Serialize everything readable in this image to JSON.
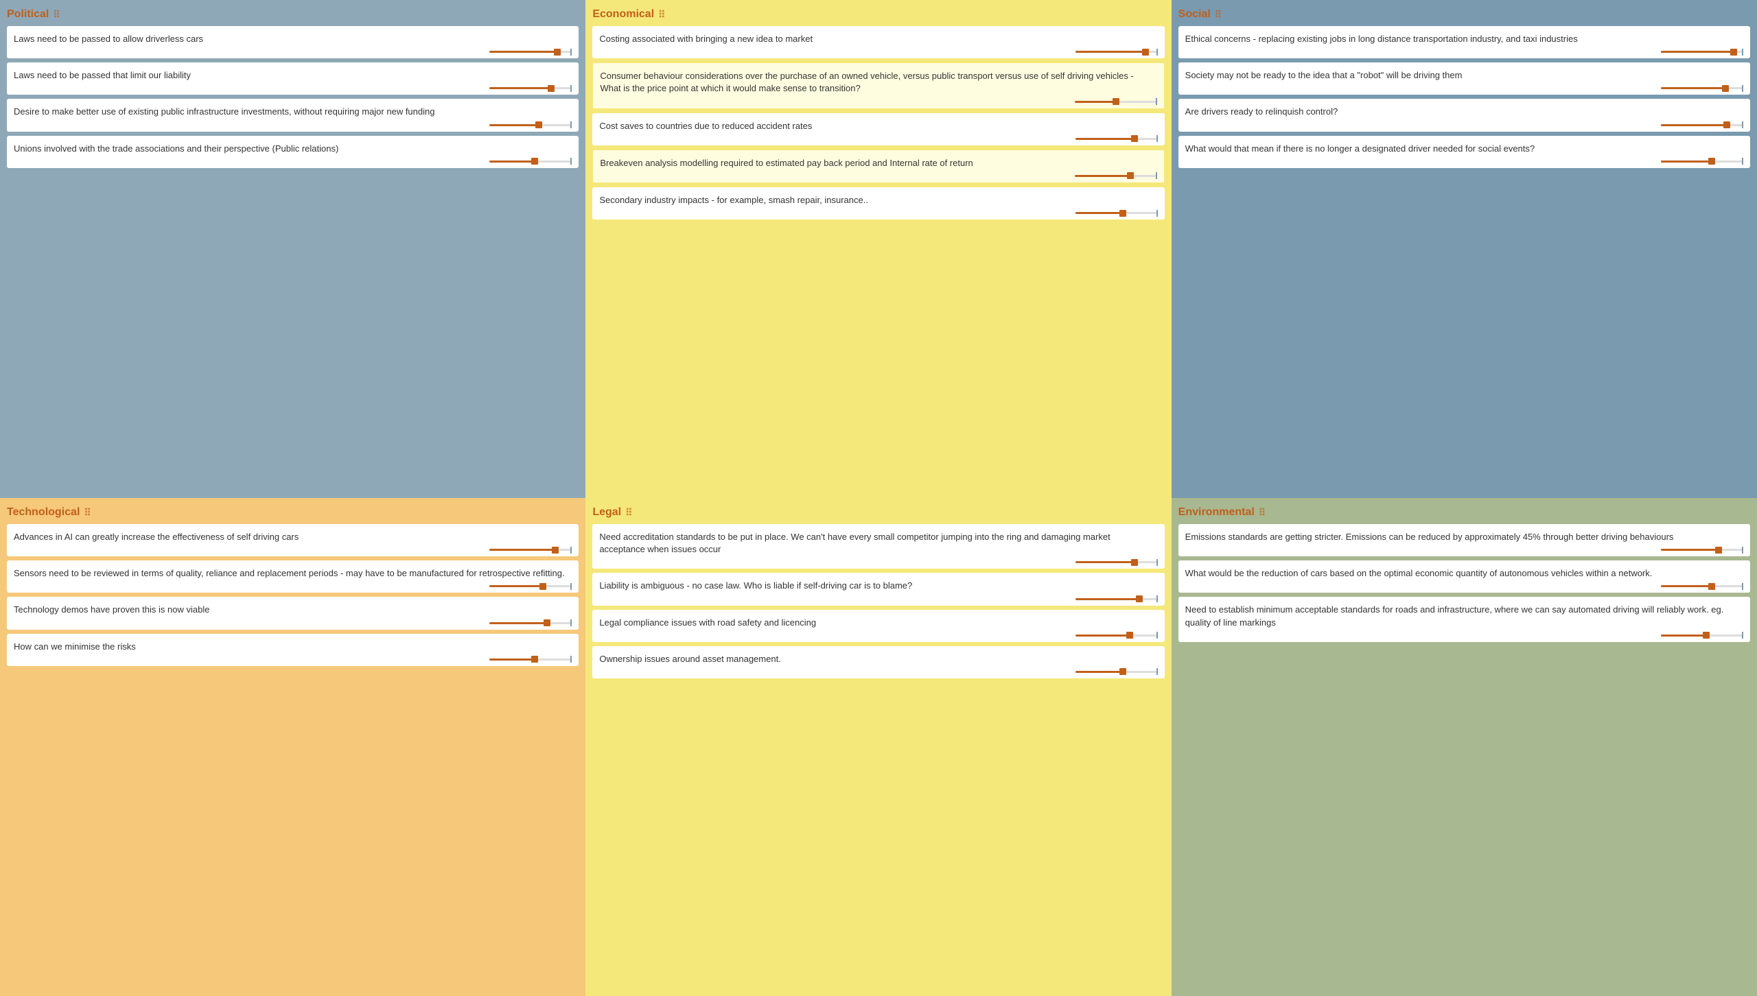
{
  "columns": [
    {
      "id": "political",
      "title": "Political",
      "colorClass": "political",
      "cards": [
        {
          "text": "Laws need to be passed to allow driverless cars",
          "sliderPct": 82
        },
        {
          "text": "Laws need to be passed that limit our liability",
          "sliderPct": 75
        },
        {
          "text": "Desire to make better use of existing public infrastructure investments, without requiring major new funding",
          "sliderPct": 60
        },
        {
          "text": "Unions involved with the trade associations and their perspective (Public relations)",
          "sliderPct": 55
        }
      ]
    },
    {
      "id": "economical",
      "title": "Economical",
      "colorClass": "economical",
      "cards": [
        {
          "text": "Costing associated with bringing a new idea to market",
          "sliderPct": 85
        },
        {
          "text": "Consumer behaviour considerations over the purchase of an owned vehicle, versus public transport versus use of self driving vehicles - What is the price point at which it would make sense to transition?",
          "sliderPct": 50,
          "highlighted": true
        },
        {
          "text": "Cost saves to countries due to reduced accident rates",
          "sliderPct": 72
        },
        {
          "text": "Breakeven analysis modelling required to estimated pay back period and Internal rate of return",
          "sliderPct": 68,
          "highlighted": true
        },
        {
          "text": "Secondary industry impacts - for example, smash repair, insurance..",
          "sliderPct": 58
        }
      ]
    },
    {
      "id": "social",
      "title": "Social",
      "colorClass": "social",
      "cards": [
        {
          "text": "Ethical concerns - replacing existing jobs in long distance transportation industry, and taxi industries",
          "sliderPct": 88
        },
        {
          "text": "Society may not be ready to the idea that a \"robot\" will be driving them",
          "sliderPct": 78
        },
        {
          "text": "Are drivers ready to relinquish control?",
          "sliderPct": 80
        },
        {
          "text": "What would that mean if there is no longer a designated driver needed for social events?",
          "sliderPct": 62
        }
      ]
    },
    {
      "id": "technological",
      "title": "Technological",
      "colorClass": "technological",
      "cards": [
        {
          "text": "Advances in AI can greatly increase the effectiveness of self driving cars",
          "sliderPct": 80
        },
        {
          "text": "Sensors need to be reviewed in terms of quality, reliance and replacement periods - may have to be manufactured for retrospective refitting.",
          "sliderPct": 65
        },
        {
          "text": "Technology demos have proven this is now viable",
          "sliderPct": 70
        },
        {
          "text": "How can we minimise the risks",
          "sliderPct": 55
        }
      ]
    },
    {
      "id": "legal",
      "title": "Legal",
      "colorClass": "legal",
      "cards": [
        {
          "text": "Need accreditation standards to be put in place. We can't have every small competitor jumping into the ring and damaging market acceptance when issues occur",
          "sliderPct": 72
        },
        {
          "text": "Liability is ambiguous - no case law. Who is liable if self-driving car is to blame?",
          "sliderPct": 78
        },
        {
          "text": "Legal compliance issues with road safety and licencing",
          "sliderPct": 66
        },
        {
          "text": "Ownership issues around asset management.",
          "sliderPct": 58
        }
      ]
    },
    {
      "id": "environmental",
      "title": "Environmental",
      "colorClass": "environmental",
      "cards": [
        {
          "text": "Emissions standards are getting stricter. Emissions can be reduced by approximately 45% through better driving behaviours",
          "sliderPct": 70
        },
        {
          "text": "What would be the reduction of cars based on the optimal economic quantity of autonomous vehicles within a network.",
          "sliderPct": 62
        },
        {
          "text": "Need to establish minimum acceptable standards for roads and infrastructure, where we can say automated driving will reliably work. eg. quality of line markings",
          "sliderPct": 55
        }
      ]
    }
  ]
}
